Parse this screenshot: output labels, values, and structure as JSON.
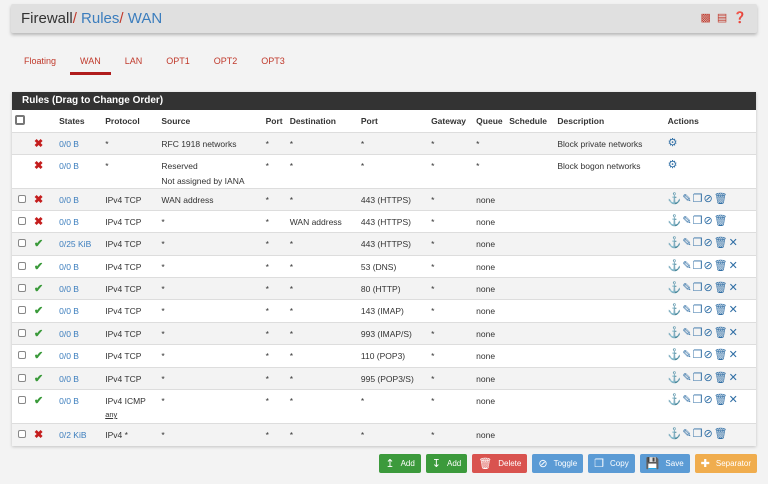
{
  "header": {
    "crumbs": [
      "Firewall",
      "Rules",
      "WAN"
    ],
    "icons": [
      "chart-icon",
      "list-icon",
      "help-icon"
    ]
  },
  "tabs": [
    "Floating",
    "WAN",
    "LAN",
    "OPT1",
    "OPT2",
    "OPT3"
  ],
  "active_tab": "WAN",
  "panel": {
    "title": "Rules (Drag to Change Order)"
  },
  "columns": [
    "States",
    "Protocol",
    "Source",
    "Port",
    "Destination",
    "Port",
    "Gateway",
    "Queue",
    "Schedule",
    "Description",
    "Actions"
  ],
  "rows": [
    {
      "checkbox": false,
      "status": "block",
      "states": "0/0 B",
      "protocol": "*",
      "source": "RFC 1918 networks",
      "sport": "*",
      "dest": "*",
      "dport": "*",
      "gateway": "*",
      "queue": "*",
      "schedule": "",
      "description": "Block private networks",
      "actions": [
        "gear"
      ]
    },
    {
      "checkbox": false,
      "status": "block",
      "states": "0/0 B",
      "protocol": "*",
      "source": "Reserved",
      "source2": "Not assigned by IANA",
      "sport": "*",
      "dest": "*",
      "dport": "*",
      "gateway": "*",
      "queue": "*",
      "schedule": "",
      "description": "Block bogon networks",
      "actions": [
        "gear"
      ]
    },
    {
      "checkbox": true,
      "status": "block",
      "states": "0/0 B",
      "protocol": "IPv4 TCP",
      "source": "WAN address",
      "sport": "*",
      "dest": "*",
      "dport": "443 (HTTPS)",
      "gateway": "*",
      "queue": "none",
      "schedule": "",
      "description": "",
      "actions": [
        "anchor",
        "edit",
        "copy",
        "disable",
        "delete"
      ]
    },
    {
      "checkbox": true,
      "status": "block",
      "states": "0/0 B",
      "protocol": "IPv4 TCP",
      "source": "*",
      "sport": "*",
      "dest": "WAN address",
      "dport": "443 (HTTPS)",
      "gateway": "*",
      "queue": "none",
      "schedule": "",
      "description": "",
      "actions": [
        "anchor",
        "edit",
        "copy",
        "disable",
        "delete"
      ]
    },
    {
      "checkbox": true,
      "status": "pass",
      "states": "0/25 KiB",
      "protocol": "IPv4 TCP",
      "source": "*",
      "sport": "*",
      "dest": "*",
      "dport": "443 (HTTPS)",
      "gateway": "*",
      "queue": "none",
      "schedule": "",
      "description": "",
      "actions": [
        "anchor",
        "edit",
        "copy",
        "disable",
        "delete",
        "remove"
      ]
    },
    {
      "checkbox": true,
      "status": "pass",
      "states": "0/0 B",
      "protocol": "IPv4 TCP",
      "source": "*",
      "sport": "*",
      "dest": "*",
      "dport": "53 (DNS)",
      "gateway": "*",
      "queue": "none",
      "schedule": "",
      "description": "",
      "actions": [
        "anchor",
        "edit",
        "copy",
        "disable",
        "delete",
        "remove"
      ]
    },
    {
      "checkbox": true,
      "status": "pass",
      "states": "0/0 B",
      "protocol": "IPv4 TCP",
      "source": "*",
      "sport": "*",
      "dest": "*",
      "dport": "80 (HTTP)",
      "gateway": "*",
      "queue": "none",
      "schedule": "",
      "description": "",
      "actions": [
        "anchor",
        "edit",
        "copy",
        "disable",
        "delete",
        "remove"
      ]
    },
    {
      "checkbox": true,
      "status": "pass",
      "states": "0/0 B",
      "protocol": "IPv4 TCP",
      "source": "*",
      "sport": "*",
      "dest": "*",
      "dport": "143 (IMAP)",
      "gateway": "*",
      "queue": "none",
      "schedule": "",
      "description": "",
      "actions": [
        "anchor",
        "edit",
        "copy",
        "disable",
        "delete",
        "remove"
      ]
    },
    {
      "checkbox": true,
      "status": "pass",
      "states": "0/0 B",
      "protocol": "IPv4 TCP",
      "source": "*",
      "sport": "*",
      "dest": "*",
      "dport": "993 (IMAP/S)",
      "gateway": "*",
      "queue": "none",
      "schedule": "",
      "description": "",
      "actions": [
        "anchor",
        "edit",
        "copy",
        "disable",
        "delete",
        "remove"
      ]
    },
    {
      "checkbox": true,
      "status": "pass",
      "states": "0/0 B",
      "protocol": "IPv4 TCP",
      "source": "*",
      "sport": "*",
      "dest": "*",
      "dport": "110 (POP3)",
      "gateway": "*",
      "queue": "none",
      "schedule": "",
      "description": "",
      "actions": [
        "anchor",
        "edit",
        "copy",
        "disable",
        "delete",
        "remove"
      ]
    },
    {
      "checkbox": true,
      "status": "pass",
      "states": "0/0 B",
      "protocol": "IPv4 TCP",
      "source": "*",
      "sport": "*",
      "dest": "*",
      "dport": "995 (POP3/S)",
      "gateway": "*",
      "queue": "none",
      "schedule": "",
      "description": "",
      "actions": [
        "anchor",
        "edit",
        "copy",
        "disable",
        "delete",
        "remove"
      ]
    },
    {
      "checkbox": true,
      "status": "pass",
      "states": "0/0 B",
      "protocol": "IPv4 ICMP",
      "protocol2": "any",
      "source": "*",
      "sport": "*",
      "dest": "*",
      "dport": "*",
      "gateway": "*",
      "queue": "none",
      "schedule": "",
      "description": "",
      "actions": [
        "anchor",
        "edit",
        "copy",
        "disable",
        "delete",
        "remove"
      ]
    },
    {
      "checkbox": true,
      "status": "block",
      "states": "0/2 KiB",
      "protocol": "IPv4 *",
      "source": "*",
      "sport": "*",
      "dest": "*",
      "dport": "*",
      "gateway": "*",
      "queue": "none",
      "schedule": "",
      "description": "",
      "actions": [
        "anchor",
        "edit",
        "copy",
        "disable",
        "delete"
      ]
    }
  ],
  "buttons": [
    {
      "label": "Add",
      "icon": "arrow-up-icon",
      "color": "#3c9a3c"
    },
    {
      "label": "Add",
      "icon": "arrow-down-icon",
      "color": "#3c9a3c"
    },
    {
      "label": "Delete",
      "icon": "trash-icon",
      "color": "#d9534f"
    },
    {
      "label": "Toggle",
      "icon": "ban-icon",
      "color": "#5b9bd5"
    },
    {
      "label": "Copy",
      "icon": "copy-icon",
      "color": "#5b9bd5"
    },
    {
      "label": "Save",
      "icon": "save-icon",
      "color": "#5b9bd5"
    },
    {
      "label": "Separator",
      "icon": "plus-icon",
      "color": "#f0ad4e"
    }
  ]
}
